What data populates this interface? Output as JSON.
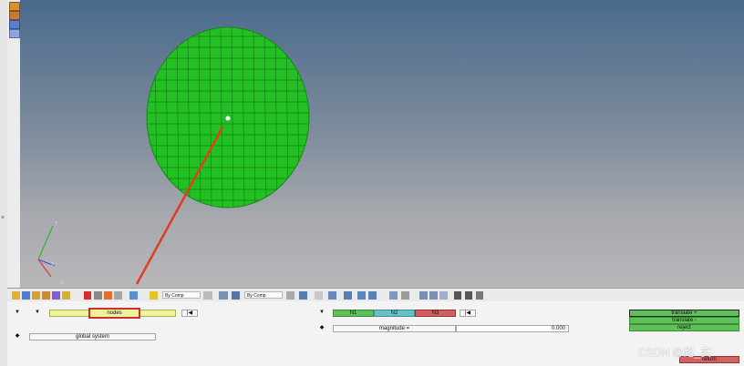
{
  "panel": {
    "selector_label": "nodes",
    "system_label": "global system",
    "n1_label": "N1",
    "n2_label": "N2",
    "n3_label": "N3",
    "magnitude_label": "magnitude =",
    "magnitude_value": "0.000"
  },
  "actions": {
    "translate_plus": "translate +",
    "translate_minus": "translate -",
    "reject": "reject",
    "return": "return"
  },
  "toolbar": {
    "by_comp_1": "By Comp",
    "by_comp_2": "By Comp"
  },
  "triad": {
    "y": "Y",
    "z": "Z",
    "x": "X"
  },
  "watermark": "CSDN @路_实",
  "colors": {
    "mesh": "#22c022",
    "vector": "#e23c22",
    "selected_border": "#d22d2d",
    "n3": "#d06060",
    "n2": "#68c0c8"
  },
  "icons": [
    "hm-logo-icon",
    "model-icon",
    "view-icon",
    "info-icon",
    "component-icon",
    "delete-icon",
    "shade-icon",
    "find-icon",
    "rotate-icon",
    "star-icon",
    "move-icon",
    "visibility-icon",
    "save-view-icon"
  ]
}
